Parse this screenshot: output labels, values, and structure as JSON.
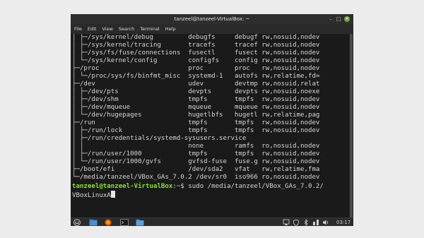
{
  "window": {
    "title": "tanzeel@tanzeel-VirtualBox: ~",
    "minimize_glyph": "–",
    "maximize_glyph": "□",
    "close_glyph": "✕"
  },
  "menu": [
    "File",
    "Edit",
    "View",
    "Search",
    "Terminal",
    "Help"
  ],
  "terminal": {
    "lines": [
      "│ ├─/sys/kernel/debug         debugfs     debugf rw,nosuid,nodev",
      "│ ├─/sys/kernel/tracing       tracefs     tracef rw,nosuid,nodev",
      "│ ├─/sys/fs/fuse/connections  fusectl     fusect rw,nosuid,nodev",
      "│ └─/sys/kernel/config        configfs    config rw,nosuid,nodev",
      "├─/proc                       proc        proc   rw,nosuid,nodev",
      "│ └─/proc/sys/fs/binfmt_misc  systemd-1   autofs rw,relatime,fd=",
      "├─/dev                        udev        devtmp rw,nosuid,relat",
      "│ ├─/dev/pts                  devpts      devpts rw,nosuid,noexe",
      "│ ├─/dev/shm                  tmpfs       tmpfs  rw,nosuid,nodev",
      "│ ├─/dev/mqueue               mqueue      mqueue rw,nosuid,nodev",
      "│ └─/dev/hugepages            hugetlbfs   hugetl rw,relatime,pag",
      "├─/run                        tmpfs       tmpfs  rw,nosuid,nodev",
      "│ ├─/run/lock                 tmpfs       tmpfs  rw,nosuid,nodev",
      "│ ├─/run/credentials/systemd-sysusers.service",
      "│ │                           none        ramfs  ro,nosuid,nodev",
      "│ ├─/run/user/1000            tmpfs       tmpfs  rw,nosuid,nodev",
      "│ └─/run/user/1000/gvfs       gvfsd-fuse  fuse.g rw,nosuid,nodev",
      "├─/boot/efi                   /dev/sda2   vfat   rw,relatime,fma",
      "└─/media/tanzeel/VBox_GAs_7.0.2 /dev/sr0  iso966 ro,nosuid,nodev"
    ],
    "prompt_user": "tanzeel@tanzeel-VirtualBox",
    "prompt_suffix": ":~$ ",
    "command_part1": "sudo /media/tanzeel/VBox_GAs_7.0.2/",
    "command_part2": "VBoxLinuxA"
  },
  "taskbar": {
    "launchers": [
      "menu-icon",
      "files-icon",
      "firefox-icon",
      "terminal-icon",
      "folder-icon"
    ],
    "clock": "03:17",
    "accent": "#6fa63b"
  }
}
